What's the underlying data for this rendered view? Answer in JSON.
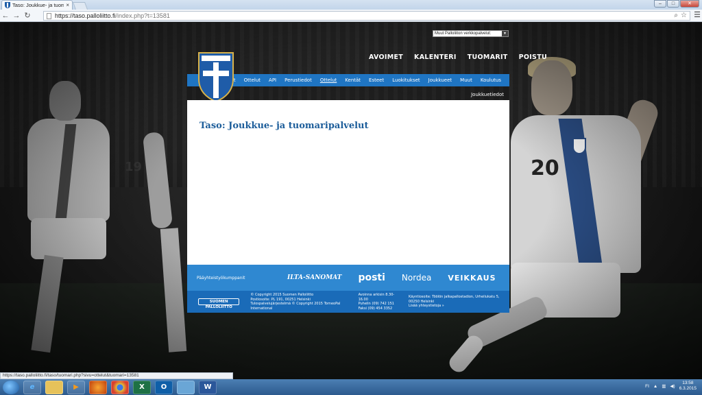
{
  "browser": {
    "tab_title": "Taso: Joukkue- ja tuomari",
    "tab_close": "×",
    "url_host": "https://taso.palloliitto.fi",
    "url_path": "/index.php?t=13581",
    "back_icon": "arrow-left-icon",
    "forward_icon": "arrow-right-icon",
    "reload_icon": "reload-icon",
    "status_url": "https://taso.palloliitto.fi/taso/tuomari.php?sivu=ottelut&tuomari=13581"
  },
  "site": {
    "service_select": "Muut Palloliiton verkkopalvelut:",
    "top_nav": [
      "AVOIMET",
      "KALENTERI",
      "TUOMARIT",
      "POISTU"
    ],
    "main_nav": [
      "Pelaajat",
      "Ottelut",
      "API",
      "Perustiedot",
      "Ottelut",
      "Kentät",
      "Esteet",
      "Luokitukset",
      "Joukkueet",
      "Muut",
      "Koulutus"
    ],
    "active_nav_index": 4,
    "sub_nav": "Joukkuetiedot",
    "page_title": "Taso: Joukkue- ja tuomaripalvelut",
    "sponsors_label": "Pääyhteistyökumppanit",
    "sponsors": [
      "ILTA-SANOMAT",
      "posti",
      "Nordea",
      "VEIKKAUS"
    ],
    "footer_logo": "SUOMEN PALLOLIITTO",
    "footer_cols": [
      [
        "© Copyright 2015 Suomen Palloliitto",
        "Postiosoite: PL 191, 00251 Helsinki",
        "Tulospalvelujärjestelmä © Copyright 2015 TorneoPal International"
      ],
      [
        "Avoinna arkisin 8.30-16.00",
        "Puhelin (09) 742 151",
        "Faksi (09) 454 3352"
      ],
      [
        "Käyntiosoite: Töölön jalkapallostadion, Urheilukatu 5, 00250 Helsinki",
        "Lisää yhteystietoja »"
      ]
    ],
    "player_numbers": [
      "19",
      "20"
    ]
  },
  "taskbar": {
    "clock_time": "13:58",
    "clock_date": "6.3.2015",
    "tray_lang": "FI"
  },
  "colors": {
    "nav_blue": "#1f75c3",
    "title_blue": "#1c5d9a",
    "sponsor_blue": "#2f88d1"
  }
}
